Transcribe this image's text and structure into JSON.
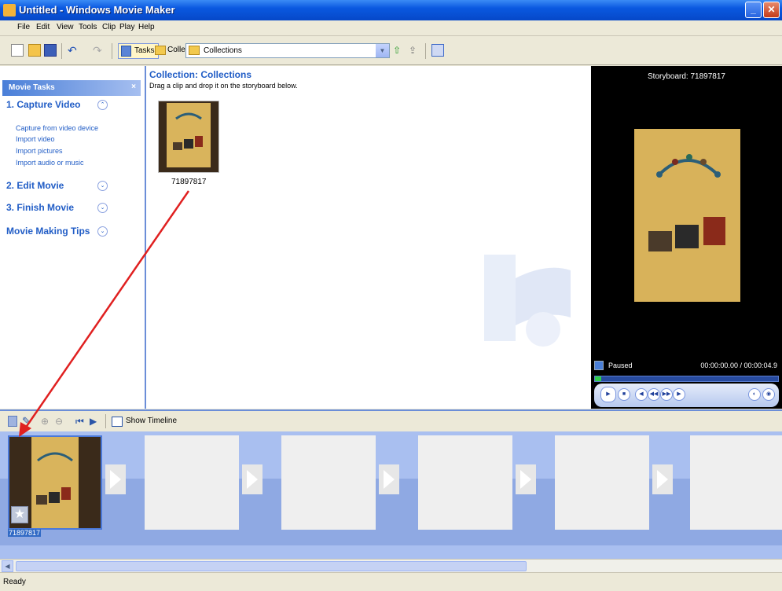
{
  "window": {
    "title": "Untitled - Windows Movie Maker",
    "buttons": {
      "minimize": "_",
      "restore": "❐",
      "close": "✕"
    }
  },
  "menubar": {
    "items": [
      "File",
      "Edit",
      "View",
      "Tools",
      "Clip",
      "Play",
      "Help"
    ]
  },
  "toolbar": {
    "tasks_label": "Tasks",
    "collections_label": "Collections",
    "collections_select": "Collections"
  },
  "tasks_pane": {
    "header": "Movie Tasks",
    "close": "×",
    "sections": [
      {
        "title": "1. Capture Video",
        "toggle": "⌃",
        "links": [
          "Capture from video device",
          "Import video",
          "Import pictures",
          "Import audio or music"
        ]
      },
      {
        "title": "2. Edit Movie",
        "toggle": "⌄"
      },
      {
        "title": "3. Finish Movie",
        "toggle": "⌄"
      },
      {
        "title": "Movie Making Tips",
        "toggle": "⌄"
      }
    ]
  },
  "collection": {
    "title": "Collection: Collections",
    "subtitle": "Drag a clip and drop it on the storyboard below.",
    "clip_label": "71897817"
  },
  "monitor": {
    "title": "Storyboard: 71897817",
    "status": "Paused",
    "time": "00:00:00.00 / 00:00:04.9"
  },
  "storyboard": {
    "show_timeline": "Show Timeline",
    "first_clip_label": "71897817"
  },
  "statusbar": {
    "text": "Ready"
  },
  "colors": {
    "accent": "#215dc6",
    "titlebar": "#0a58e0",
    "storyboard_bg": "#a9bff0",
    "arrow": "#e02020"
  }
}
